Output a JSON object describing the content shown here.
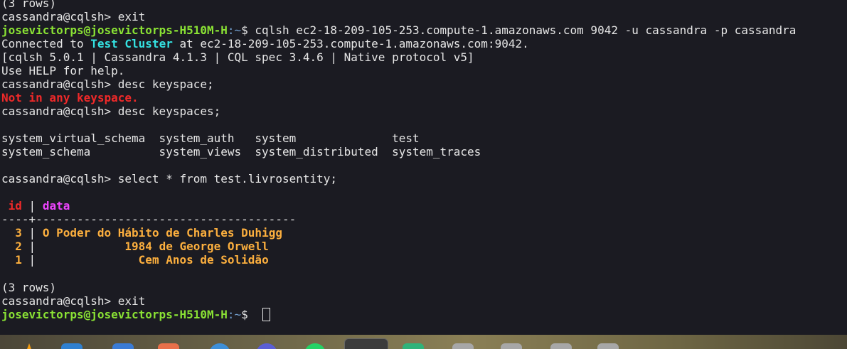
{
  "terminal": {
    "lines": {
      "l01": "(3 rows)",
      "l02": "cassandra@cqlsh> exit",
      "l03_user": "josevictorps@josevictorps-H510M-H",
      "l03_path": ":~",
      "l03_cmd": "$ cqlsh ec2-18-209-105-253.compute-1.amazonaws.com 9042 -u cassandra -p cassandra",
      "l04_pre": "Connected to ",
      "l04_cluster": "Test Cluster",
      "l04_post": " at ec2-18-209-105-253.compute-1.amazonaws.com:9042.",
      "l05": "[cqlsh 5.0.1 | Cassandra 4.1.3 | CQL spec 3.4.6 | Native protocol v5]",
      "l06": "Use HELP for help.",
      "l07": "cassandra@cqlsh> desc keyspace;",
      "l08": "Not in any keyspace.",
      "l09": "cassandra@cqlsh> desc keyspaces;",
      "l11": "system_virtual_schema  system_auth   system              test",
      "l12": "system_schema          system_views  system_distributed  system_traces",
      "l14": "cassandra@cqlsh> select * from test.livrosentity;",
      "l16_id": " id",
      "l16_sep": " | ",
      "l16_data": "data",
      "l17": "----+--------------------------------------",
      "rows": [
        {
          "id": "  3",
          "sep": " | ",
          "data": "O Poder do Hábito de Charles Duhigg"
        },
        {
          "id": "  2",
          "sep": " | ",
          "data": "            1984 de George Orwell"
        },
        {
          "id": "  1",
          "sep": " | ",
          "data": "              Cem Anos de Solidão"
        }
      ],
      "l22": "(3 rows)",
      "l23": "cassandra@cqlsh> exit",
      "l24_user": "josevictorps@josevictorps-H510M-H",
      "l24_path": ":~",
      "l24_cmd": "$ "
    }
  },
  "colors": {
    "background": "#1b1b22",
    "prompt_user": "#8ae234",
    "cluster": "#34e2e2",
    "error": "#ef2929",
    "header_id": "#ef2929",
    "header_data": "#ee44ff",
    "row_values": "#fcaf3e"
  },
  "taskbar": {
    "icons": [
      "vlc-icon",
      "files-icon",
      "text-editor-icon",
      "store-icon",
      "browser-icon",
      "app-icon",
      "whatsapp-icon",
      "terminal-icon",
      "app-green-icon",
      "app-icon-1",
      "app-icon-2",
      "app-icon-3",
      "app-icon-4"
    ]
  }
}
